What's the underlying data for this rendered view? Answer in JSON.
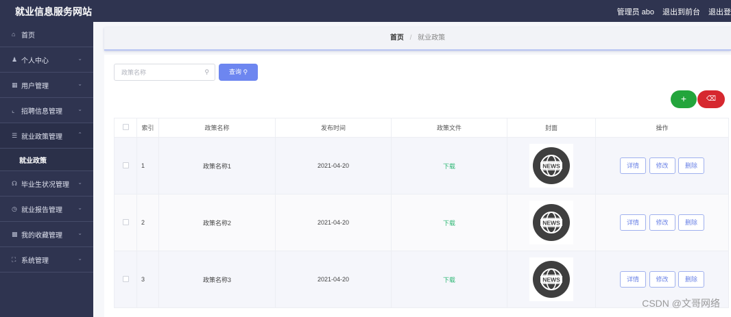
{
  "app": {
    "title": "就业信息服务网站",
    "user": "管理员 abo",
    "to_front": "退出到前台",
    "logout": "退出登"
  },
  "sidebar": {
    "items": [
      {
        "label": "首页",
        "icon": "home-icon"
      },
      {
        "label": "个人中心",
        "icon": "user-icon"
      },
      {
        "label": "用户管理",
        "icon": "grid-icon"
      },
      {
        "label": "招聘信息管理",
        "icon": "crop-icon"
      },
      {
        "label": "就业政策管理",
        "icon": "bank-icon"
      },
      {
        "label": "毕业生状况管理",
        "icon": "mic-icon"
      },
      {
        "label": "就业报告管理",
        "icon": "clock-icon"
      },
      {
        "label": "我的收藏管理",
        "icon": "trash-icon"
      },
      {
        "label": "系统管理",
        "icon": "expand-icon"
      }
    ],
    "sub_active": "就业政策"
  },
  "breadcrumb": {
    "home": "首页",
    "sep": "/",
    "current": "就业政策"
  },
  "search": {
    "placeholder": "政策名称",
    "button": "查询"
  },
  "table": {
    "headers": [
      "索引",
      "政策名称",
      "发布时间",
      "政策文件",
      "封面",
      "操作"
    ],
    "rows": [
      {
        "index": "1",
        "name": "政策名称1",
        "date": "2021-04-20",
        "file": "下载",
        "cover": "NEWS"
      },
      {
        "index": "2",
        "name": "政策名称2",
        "date": "2021-04-20",
        "file": "下载",
        "cover": "NEWS"
      },
      {
        "index": "3",
        "name": "政策名称3",
        "date": "2021-04-20",
        "file": "下载",
        "cover": "NEWS"
      }
    ],
    "actions": {
      "detail": "详情",
      "edit": "修改",
      "delete": "删除"
    }
  },
  "watermark": "CSDN @文哥网络",
  "colors": {
    "sidebar": "#2f3450",
    "primary": "#6d86f0",
    "add": "#23a53c",
    "danger": "#d6282f",
    "download": "#2bb673"
  }
}
